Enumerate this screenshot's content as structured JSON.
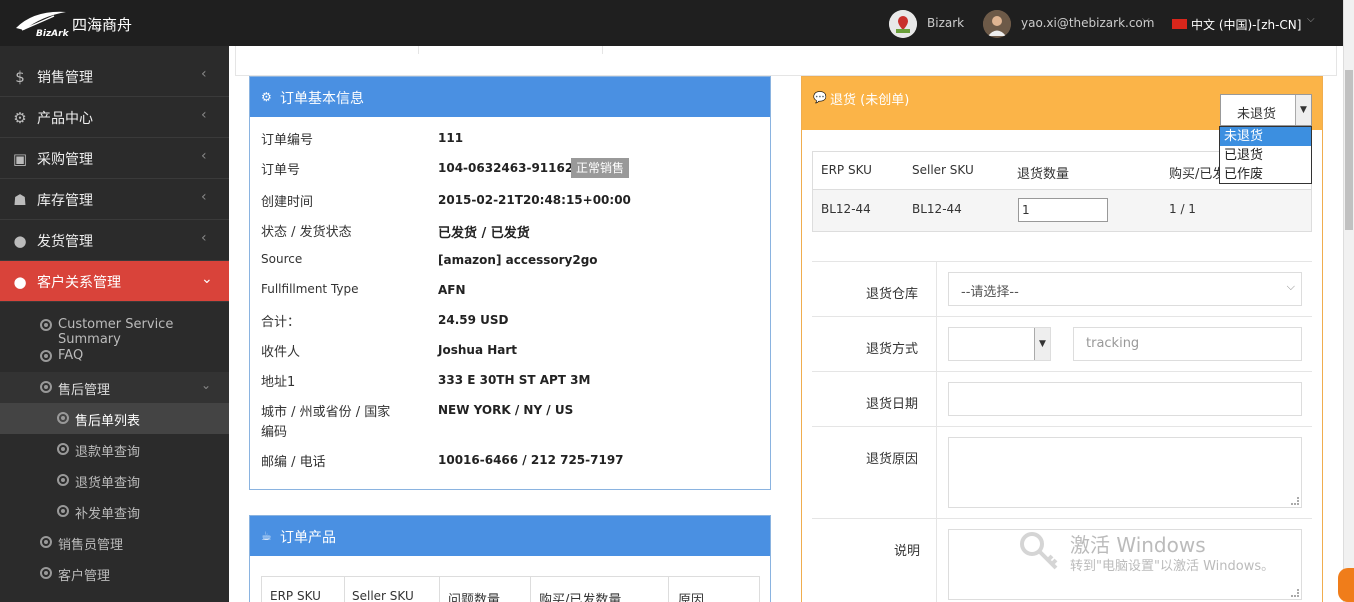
{
  "topbar": {
    "brand": "四海商舟",
    "logo_text": "BizArk",
    "bizark_label": "Bizark",
    "user_email": "yao.xi@thebizark.com",
    "language": "中文 (中国)-[zh-CN]"
  },
  "sidebar": {
    "items": [
      {
        "label": "销售管理"
      },
      {
        "label": "产品中心"
      },
      {
        "label": "采购管理"
      },
      {
        "label": "库存管理"
      },
      {
        "label": "发货管理"
      },
      {
        "label": "客户关系管理"
      }
    ],
    "sub_items": [
      {
        "label": "Customer Service Summary"
      },
      {
        "label": "FAQ"
      },
      {
        "label": "售后管理"
      },
      {
        "label": "售后单列表"
      },
      {
        "label": "退款单查询"
      },
      {
        "label": "退货单查询"
      },
      {
        "label": "补发单查询"
      },
      {
        "label": "销售员管理"
      },
      {
        "label": "客户管理"
      }
    ]
  },
  "order_info": {
    "title": "订单基本信息",
    "rows": [
      {
        "label": "订单编号",
        "value": "111"
      },
      {
        "label": "订单号",
        "value": "104-0632463-9116222"
      },
      {
        "label": "创建时间",
        "value": "2015-02-21T20:48:15+00:00"
      },
      {
        "label": "状态 / 发货状态",
        "value": "已发货 / 已发货"
      },
      {
        "label": "Source",
        "value": "[amazon] accessory2go"
      },
      {
        "label": "Fullfillment Type",
        "value": "AFN"
      },
      {
        "label": "合计：",
        "value": "24.59 USD"
      },
      {
        "label": "收件人",
        "value": "Joshua Hart"
      },
      {
        "label": "地址1",
        "value": "333 E 30TH ST APT 3M"
      },
      {
        "label": "城市 / 州或省份 / 国家",
        "label2": "编码",
        "value": "NEW YORK / NY / US"
      },
      {
        "label": "邮编 / 电话",
        "value": "10016-6466 / 212 725-7197"
      }
    ],
    "badge": "正常销售"
  },
  "order_products": {
    "title": "订单产品",
    "headers": [
      "ERP SKU",
      "Seller SKU",
      "问题数量",
      "购买/已发数量",
      "原因"
    ]
  },
  "return_panel": {
    "title": "退货 (未创单)",
    "status_select": "未退货",
    "status_options": [
      "未退货",
      "已退货",
      "已作废"
    ],
    "table_headers": [
      "ERP SKU",
      "Seller SKU",
      "退货数量",
      "购买/已发"
    ],
    "row": {
      "erp_sku": "BL12-44",
      "seller_sku": "BL12-44",
      "qty": "1",
      "bought_sent": "1 / 1"
    },
    "form": {
      "warehouse_label": "退货仓库",
      "warehouse_placeholder": "--请选择--",
      "method_label": "退货方式",
      "tracking_placeholder": "tracking",
      "date_label": "退货日期",
      "reason_label": "退货原因",
      "note_label": "说明"
    }
  },
  "watermark": {
    "title": "激活 Windows",
    "subtitle": "转到\"电脑设置\"以激活 Windows。"
  },
  "colors": {
    "topbar": "#1f1f1f",
    "sidebar": "#2b2b2b",
    "active_nav": "#d9433a",
    "panel_blue": "#4a90e2",
    "panel_orange": "#fbb448"
  }
}
